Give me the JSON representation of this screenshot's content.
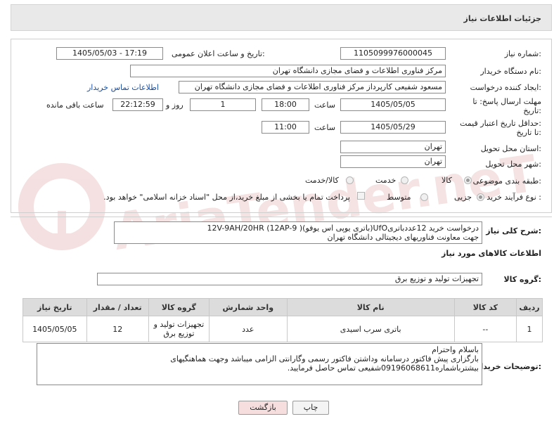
{
  "header": {
    "title": "جزئیات اطلاعات نیاز"
  },
  "watermark": {
    "text": "AriaTender.neT"
  },
  "form": {
    "need_number": {
      "label": "شماره نیاز:",
      "value": "1105099976000045"
    },
    "announce": {
      "label": "تاریخ و ساعت اعلان عمومی:",
      "value": "1405/05/03 - 17:19"
    },
    "buyer_org": {
      "label": "نام دستگاه خریدار:",
      "value": "مرکز فناوری اطلاعات و فضای مجازی دانشگاه تهران"
    },
    "creator": {
      "label": "ایجاد کننده درخواست:",
      "value": "مسعود شفیعی کارپرداز مرکز فناوری اطلاعات و فضای مجازی دانشگاه تهران",
      "contact_link": "اطلاعات تماس خریدار"
    },
    "reply_deadline": {
      "label_line1": "مهلت ارسال پاسخ: تا",
      "label_line2": "تاریخ:",
      "date": "1405/05/05",
      "time_label": "ساعت",
      "time": "18:00",
      "days": "1",
      "days_label": "روز و",
      "remaining": "22:12:59",
      "remaining_label": "ساعت باقی مانده"
    },
    "price_deadline": {
      "label_line1": "حداقل تاریخ اعتبار قیمت:",
      "label_line2": "تا تاریخ:",
      "date": "1405/05/29",
      "time_label": "ساعت",
      "time": "11:00"
    },
    "province": {
      "label": "استان محل تحویل:",
      "value": "تهران"
    },
    "city": {
      "label": "شهر محل تحویل:",
      "value": "تهران"
    },
    "category": {
      "label": "طبقه بندی موضوعی:",
      "options": [
        "کالا",
        "خدمت",
        "کالا/خدمت"
      ],
      "selected": "کالا"
    },
    "process": {
      "label": "نوع فرآیند خرید :",
      "options": [
        "جزیی",
        "متوسط"
      ],
      "selected": "جزیی",
      "note": "پرداخت تمام یا بخشی از مبلغ خرید،از محل \"اسناد خزانه اسلامی\" خواهد بود."
    }
  },
  "summary": {
    "label": "شرح کلی نیاز:",
    "line1": "درخواست خرید 12عددباتریUfO(باتری یوپی اس یوفو)12V-9AH/20HR  (12AP-9 )",
    "line2": "جهت معاونت فناوریهای دیجیتالی دانشگاه تهران"
  },
  "goods_section": {
    "title": "اطلاعات کالاهای مورد نیاز"
  },
  "goods_group": {
    "label": "گروه کالا:",
    "value": "تجهیزات تولید و توزیع برق"
  },
  "table": {
    "headers": [
      "ردیف",
      "کد کالا",
      "نام کالا",
      "واحد شمارش",
      "گروه کالا",
      "تعداد / مقدار",
      "تاریخ نیاز"
    ],
    "rows": [
      {
        "row": "1",
        "code": "--",
        "name": "باتری سرب اسیدی",
        "unit": "عدد",
        "group": "تجهیزات تولید و توزیع برق",
        "qty": "12",
        "date": "1405/05/05"
      }
    ]
  },
  "buyer_notes": {
    "label": "توضیحات خریدار:",
    "line1": "باسلام واحترام",
    "line2": "بارگزاری پیش فاکتور درسامانه وداشتن فاکتور رسمی وگارانتی الزامی میباشد وجهت هماهنگیهای",
    "line3": "بیشترباشماره09196068611شفیعی تماس حاصل فرمایید."
  },
  "buttons": {
    "print": "چاپ",
    "back": "بازگشت"
  },
  "colors": {
    "accent_link": "#1a4ea0",
    "back_button": "#f6dede",
    "header_bg": "#e9e9e9"
  }
}
